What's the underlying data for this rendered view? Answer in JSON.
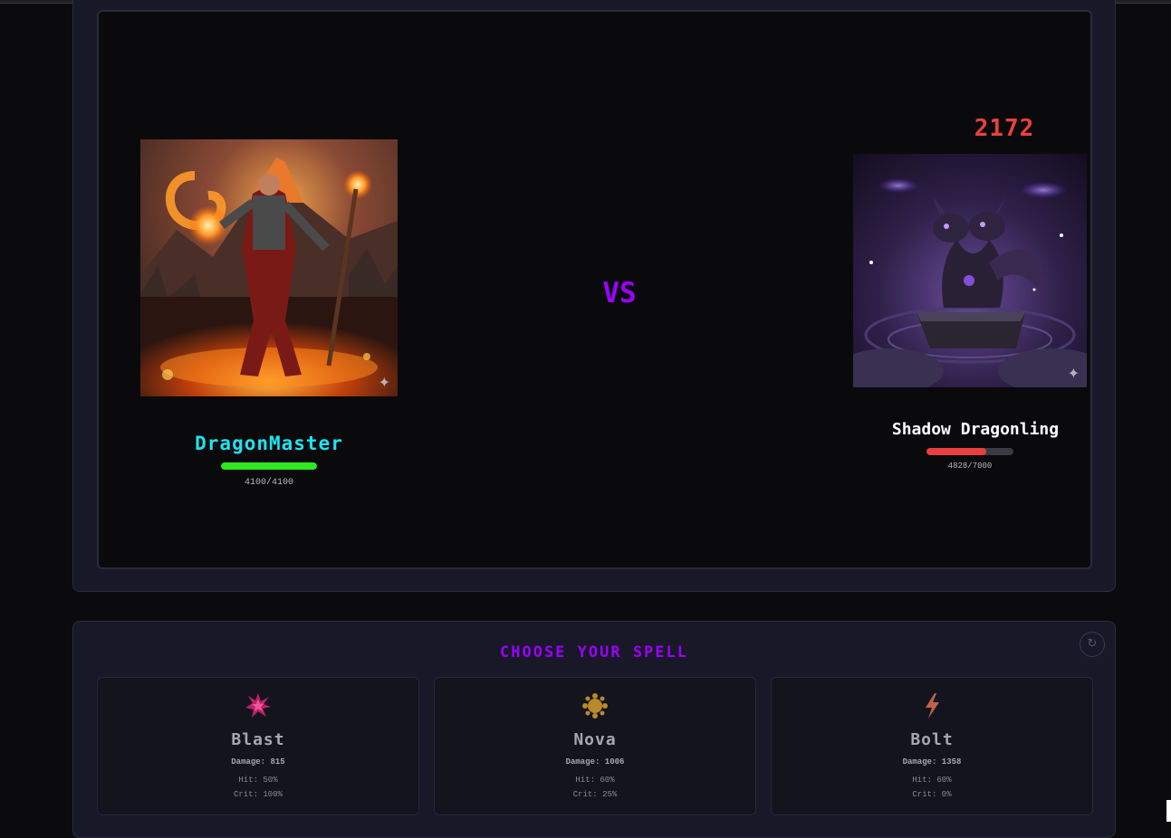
{
  "battle": {
    "player": {
      "name": "DragonMaster",
      "hp_text": "4100/4100",
      "hp_current": 4100,
      "hp_max": 4100,
      "portrait": "fire-mage-portrait"
    },
    "vs_label": "VS",
    "enemy": {
      "name": "Shadow Dragonling",
      "hp_text": "4828/7000",
      "hp_current": 4828,
      "hp_max": 7000,
      "portrait": "shadow-dragon-portrait",
      "damage_popup": "2172"
    }
  },
  "spells": {
    "title": "CHOOSE YOUR SPELL",
    "refresh_icon": "refresh-icon",
    "items": [
      {
        "name": "Blast",
        "icon": "explosion-icon",
        "icon_color": "#c0206a",
        "damage": "Damage: 815",
        "hit": "Hit: 50%",
        "crit": "Crit: 100%"
      },
      {
        "name": "Nova",
        "icon": "nova-icon",
        "icon_color": "#b88a2a",
        "damage": "Damage: 1006",
        "hit": "Hit: 60%",
        "crit": "Crit: 25%"
      },
      {
        "name": "Bolt",
        "icon": "lightning-icon",
        "icon_color": "#c0634a",
        "damage": "Damage: 1358",
        "hit": "Hit: 60%",
        "crit": "Crit: 0%"
      }
    ]
  },
  "colors": {
    "player_name": "#1fe3f0",
    "player_hp": "#2ee822",
    "enemy_hp": "#e84040",
    "vs": "#9a00ff",
    "damage_popup": "#e8413e",
    "title": "#9b00ff"
  }
}
